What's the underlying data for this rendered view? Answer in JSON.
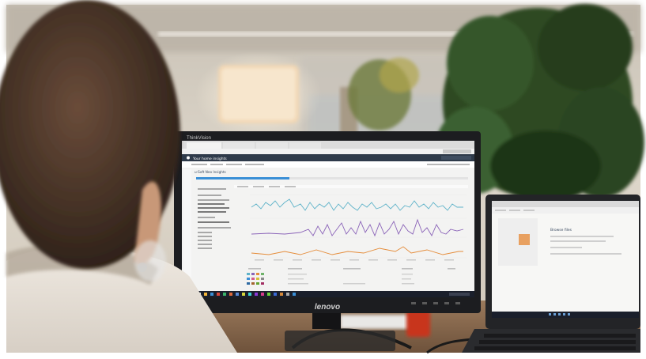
{
  "photo": {
    "monitor": {
      "bezel_brand_top": "ThinkVision",
      "bezel_brand_bottom": "lenovo"
    },
    "monitor_screen": {
      "app_header": "Your home insights",
      "page_title": "u-Soft Neo Insights",
      "browser_tabs": [
        "",
        "",
        "",
        ""
      ],
      "sidebar_lines": 14,
      "chart": {
        "series_colors": [
          "#5fb3c9",
          "#8a63b8",
          "#e58c3a"
        ]
      },
      "table_headers": [
        "",
        "",
        "",
        ""
      ]
    },
    "laptop_screen": {
      "page_title": "Browse files"
    },
    "colors": {
      "wall": "#d9d2c6",
      "plant": "#2d4a23",
      "desk": "#8b6b4f",
      "monitor_frame": "#1c1d20",
      "screen_bg": "#f3f3f2",
      "taskbar": "#1a1f2b",
      "hair": "#4a3528",
      "skin": "#c89878",
      "shirt": "#e8e2da"
    }
  }
}
